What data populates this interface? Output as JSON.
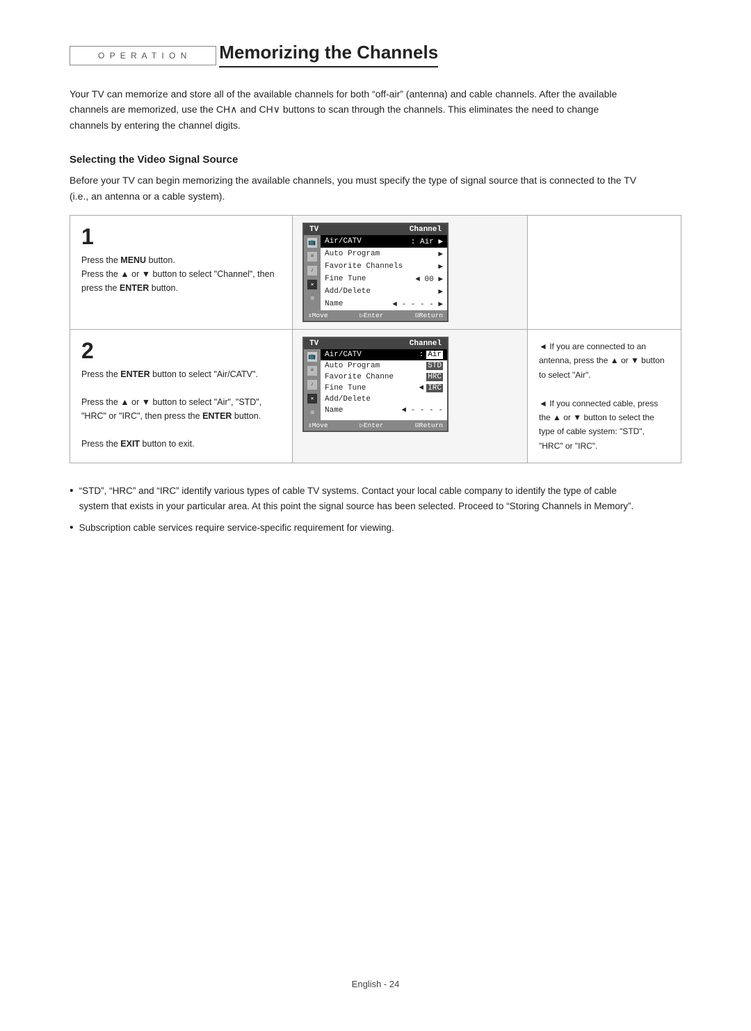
{
  "header": {
    "operation_label": "O P E R A T I O N"
  },
  "page": {
    "title": "Memorizing the Channels",
    "intro": "Your TV can memorize and store all of the available channels for both “off-air” (antenna) and cable channels. After the available channels are memorized, use the CH∧ and CH∨ buttons to scan through the channels. This eliminates the need to change channels by entering the channel digits.",
    "section_heading": "Selecting the Video Signal Source",
    "section_subtext": "Before your TV can begin memorizing the available channels, you must specify the type of signal source that is connected to the TV (i.e., an antenna or a cable system)."
  },
  "steps": [
    {
      "number": "1",
      "text_parts": [
        "Press the ",
        "MENU",
        " button.",
        "\nPress the ▲ or ▼ button to select “Channel”, then press the ",
        "ENTER",
        " button."
      ],
      "menu": {
        "header_left": "TV",
        "header_right": "Channel",
        "items": [
          {
            "label": "Air/CATV",
            "sep": ":",
            "value": "Air",
            "arrow": "right",
            "highlighted": false
          },
          {
            "label": "Auto Program",
            "sep": "",
            "value": "",
            "arrow": "right",
            "highlighted": false
          },
          {
            "label": "Favorite Channels",
            "sep": "",
            "value": "",
            "arrow": "right",
            "highlighted": false
          },
          {
            "label": "Fine Tune",
            "sep": "◄",
            "value": "00",
            "arrow": "right",
            "highlighted": false
          },
          {
            "label": "Add/Delete",
            "sep": "",
            "value": "",
            "arrow": "right",
            "highlighted": false
          },
          {
            "label": "Name",
            "sep": "◄",
            "value": "- - - -",
            "arrow": "right",
            "highlighted": false
          }
        ],
        "footer": "↕Move   ▷Enter   ☐Return"
      },
      "right_text": ""
    },
    {
      "number": "2",
      "text_parts": [
        "Press the ",
        "ENTER",
        " button to select “Air/CATV”.",
        "\n\nPress the ▲ or ▼ button to select “Air”, “STD”, “HRC” or “IRC”, then press the ",
        "ENTER",
        " button.",
        "\n\nPress the ",
        "EXIT",
        " button to exit."
      ],
      "menu": {
        "header_left": "TV",
        "header_right": "Channel",
        "items": [
          {
            "label": "Air/CATV",
            "sep": ":",
            "value": "Air",
            "arrow": "",
            "highlighted": true
          },
          {
            "label": "Auto Program",
            "sep": "",
            "value": "STD",
            "arrow": "",
            "highlighted": false,
            "value_box": true
          },
          {
            "label": "Favorite Channe",
            "sep": "",
            "value": "HRC",
            "arrow": "",
            "highlighted": false,
            "value_box": true
          },
          {
            "label": "Fine Tune",
            "sep": "◄",
            "value": "IRC",
            "arrow": "",
            "highlighted": false,
            "value_box": true
          },
          {
            "label": "Add/Delete",
            "sep": "",
            "value": "",
            "arrow": "",
            "highlighted": false
          },
          {
            "label": "Name",
            "sep": "◄",
            "value": "- - - -",
            "arrow": "",
            "highlighted": false
          }
        ],
        "footer": "↕Move   ▷Enter   ☐Return"
      },
      "right_text_lines": [
        "◄ If you are connected to an antenna, press the ▲ or ▼ button to select “Air”.",
        "◄ If you connected cable, press the ▲ or ▼ button to select the type of cable system: “STD”, “HRC” or “IRC”."
      ]
    }
  ],
  "notes": [
    "“STD”, “HRC” and “IRC” identify various types of cable TV systems. Contact your local cable company to identify the type of cable system that exists in your particular area. At this point the signal source has been selected. Proceed to “Storing Channels in Memory”.",
    "Subscription cable services require service-specific requirement for viewing."
  ],
  "footer": {
    "label": "English - 24"
  }
}
